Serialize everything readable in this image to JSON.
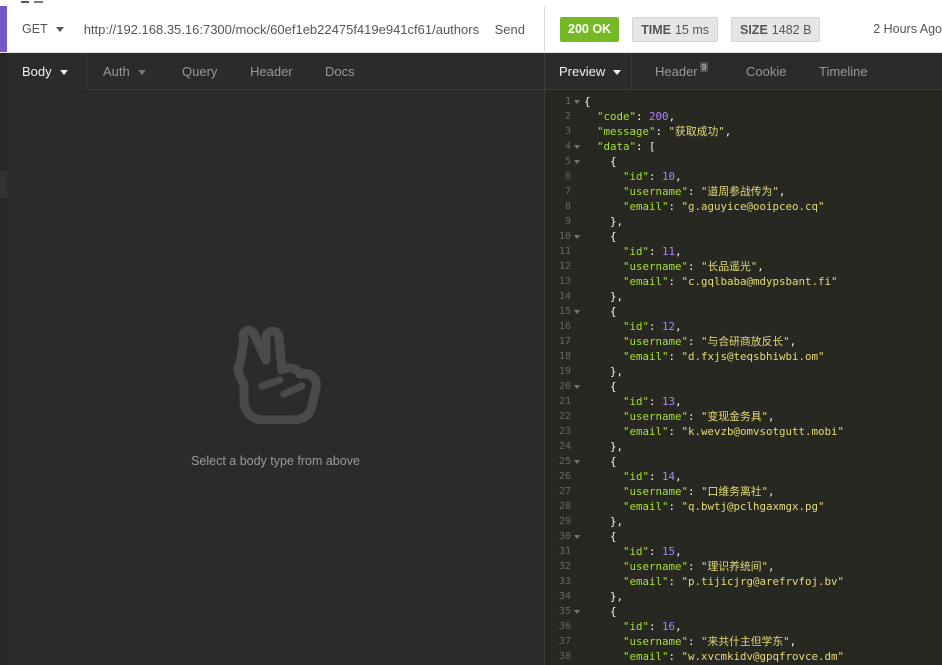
{
  "request": {
    "method": "GET",
    "url": "http://192.168.35.16:7300/mock/60ef1eb22475f419e941cf61/authors",
    "send_label": "Send"
  },
  "response": {
    "status": "200 OK",
    "time_label": "TIME",
    "time_value": "15 ms",
    "size_label": "SIZE",
    "size_value": "1482 B",
    "ago": "2 Hours Ago"
  },
  "left_tabs": {
    "body": "Body",
    "auth": "Auth",
    "query": "Query",
    "header": "Header",
    "docs": "Docs"
  },
  "left_body": {
    "empty_message": "Select a body type from above"
  },
  "right_tabs": {
    "preview": "Preview",
    "header": "Header",
    "header_count": "9",
    "cookie": "Cookie",
    "timeline": "Timeline"
  },
  "colors": {
    "accent": "#7756c7",
    "status_ok": "#75ba24",
    "json_key": "#a6e22e",
    "json_string": "#e6db74",
    "json_number": "#ae81ff"
  },
  "json_top": {
    "code_key": "\"code\"",
    "code_value": "200",
    "message_key": "\"message\"",
    "message_value": "\"获取成功\"",
    "data_key": "\"data\""
  },
  "json_items": [
    {
      "id": "10",
      "username": "\"道周参战传为\"",
      "email": "\"g.aguyice@ooipceo.cq\""
    },
    {
      "id": "11",
      "username": "\"长品遥光\"",
      "email": "\"c.gqlbaba@mdypsbant.fi\""
    },
    {
      "id": "12",
      "username": "\"与合研商放反长\"",
      "email": "\"d.fxjs@teqsbhiwbi.om\""
    },
    {
      "id": "13",
      "username": "\"变现金务具\"",
      "email": "\"k.wevzb@omvsotgutt.mobi\""
    },
    {
      "id": "14",
      "username": "\"口维务离社\"",
      "email": "\"q.bwtj@pclhgaxmgx.pg\""
    },
    {
      "id": "15",
      "username": "\"理识养统间\"",
      "email": "\"p.tijicjrg@arefrvfoj.bv\""
    },
    {
      "id": "16",
      "username": "\"来共什主但学东\"",
      "email": "\"w.xvcmkidv@gpqfrovce.dm\""
    }
  ]
}
